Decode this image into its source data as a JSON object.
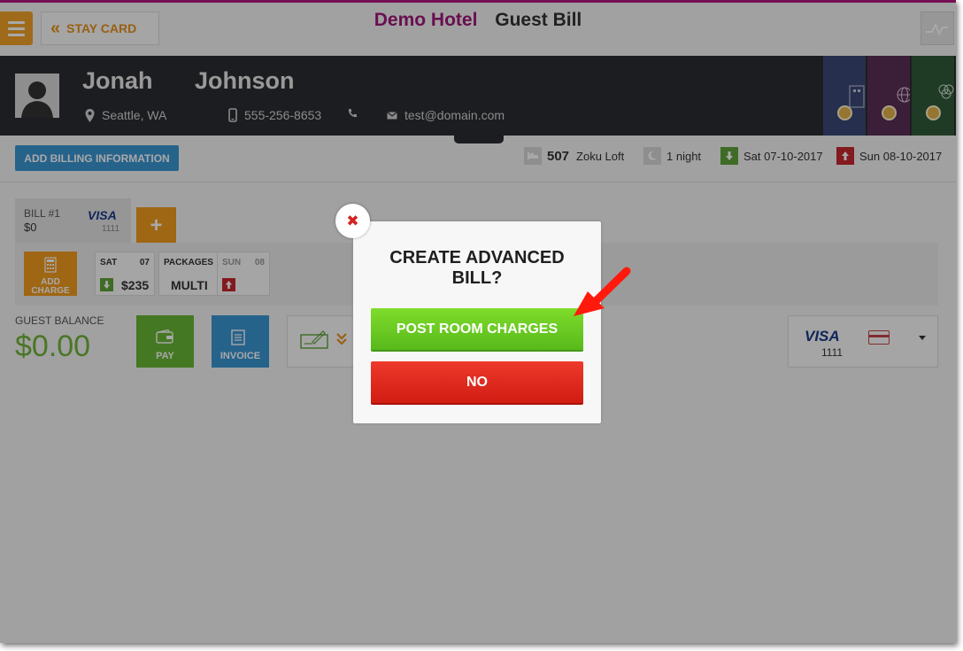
{
  "header": {
    "menu_icon": "hamburger-icon",
    "back_label": "STAY CARD",
    "hotel_name": "Demo Hotel",
    "page_title": "Guest Bill",
    "graph_icon": "activity-graph-icon"
  },
  "guest": {
    "first_name": "Jonah",
    "last_name": "Johnson",
    "location": "Seattle, WA",
    "phone": "555-256-8653",
    "email": "test@domain.com"
  },
  "toolbar": {
    "add_billing_label": "ADD BILLING INFORMATION"
  },
  "reservation": {
    "room_number": "507",
    "room_type": "Zoku Loft",
    "nights": "1 night",
    "arrival": "Sat 07-10-2017",
    "departure": "Sun 08-10-2017"
  },
  "bill": {
    "tab_label": "BILL #1",
    "tab_amount": "$0",
    "tab_card_brand": "VISA",
    "tab_card_number": "1111",
    "add_bill_symbol": "+",
    "add_charge_label": "ADD CHARGE",
    "days": [
      {
        "name": "SAT",
        "number": "07",
        "value": "$235"
      },
      {
        "name": "PACKAGES",
        "value": "MULTI"
      },
      {
        "name": "SUN",
        "number": "08"
      }
    ]
  },
  "balance": {
    "label": "GUEST BALANCE",
    "value": "$0.00"
  },
  "actions": {
    "pay_label": "PAY",
    "invoice_label": "INVOICE"
  },
  "payment_method": {
    "brand": "VISA",
    "number": "1111"
  },
  "modal": {
    "title": "CREATE ADVANCED\nBILL?",
    "post_label": "POST ROOM CHARGES",
    "no_label": "NO",
    "close_symbol": "✖"
  },
  "colors": {
    "brand": "#a0187c",
    "accent_orange": "#f29b1f",
    "pay_green": "#69b736",
    "invoice_blue": "#3a96d3",
    "post_green": "#6bcb25",
    "no_red": "#e22b1f"
  }
}
